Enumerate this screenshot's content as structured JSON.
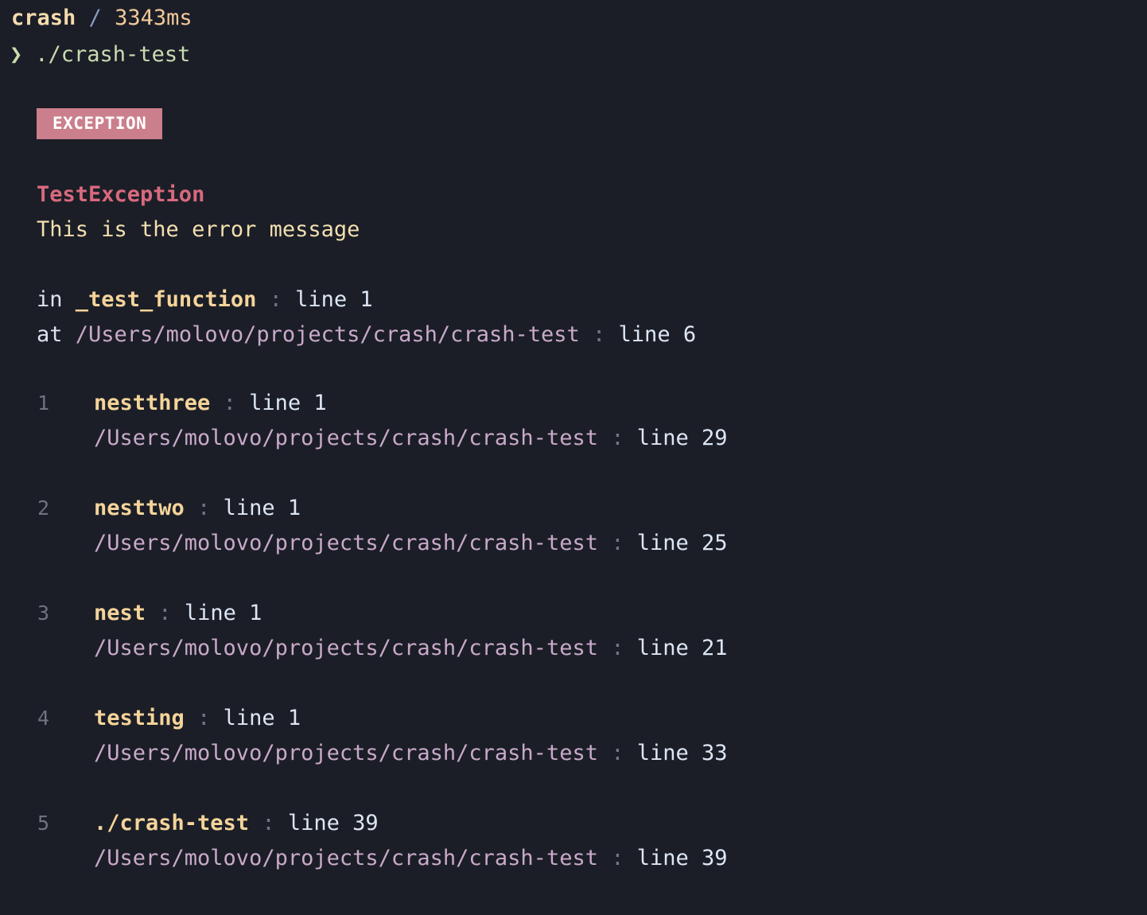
{
  "header": {
    "app": "crash",
    "separator": "/",
    "duration": "3343ms"
  },
  "prompt": {
    "arrow_icon": "chevron-right-icon",
    "arrow": "❯",
    "command": "./crash-test"
  },
  "badge": {
    "label": "EXCEPTION",
    "background": "#cb7f8c",
    "color": "#ffffff"
  },
  "exception": {
    "title": "TestException",
    "message": "This is the error message",
    "title_color": "#d9697e",
    "message_color": "#f3dfb0"
  },
  "origin": {
    "in_keyword": "in",
    "function": "_test_function",
    "colon": ":",
    "line_label": "line 1",
    "at_keyword": "at",
    "path": "/Users/molovo/projects/crash/crash-test",
    "at_colon": ":",
    "at_line_label": "line 6"
  },
  "frames": [
    {
      "index": "1",
      "name": "nestthree",
      "colon": ":",
      "line": "line 1",
      "path": "/Users/molovo/projects/crash/crash-test",
      "path_colon": ":",
      "path_line": "line 29"
    },
    {
      "index": "2",
      "name": "nesttwo",
      "colon": ":",
      "line": "line 1",
      "path": "/Users/molovo/projects/crash/crash-test",
      "path_colon": ":",
      "path_line": "line 25"
    },
    {
      "index": "3",
      "name": "nest",
      "colon": ":",
      "line": "line 1",
      "path": "/Users/molovo/projects/crash/crash-test",
      "path_colon": ":",
      "path_line": "line 21"
    },
    {
      "index": "4",
      "name": "testing",
      "colon": ":",
      "line": "line 1",
      "path": "/Users/molovo/projects/crash/crash-test",
      "path_colon": ":",
      "path_line": "line 33"
    },
    {
      "index": "5",
      "name": "./crash-test",
      "colon": ":",
      "line": "line 39",
      "path": "/Users/molovo/projects/crash/crash-test",
      "path_colon": ":",
      "path_line": "line 39"
    }
  ],
  "theme": {
    "background": "#1b1e27",
    "function_color": "#f5d49a",
    "path_color": "#c9a9c9",
    "muted_color": "#6d737f",
    "text_color": "#dde6f5",
    "prompt_color": "#c8dcb0"
  }
}
